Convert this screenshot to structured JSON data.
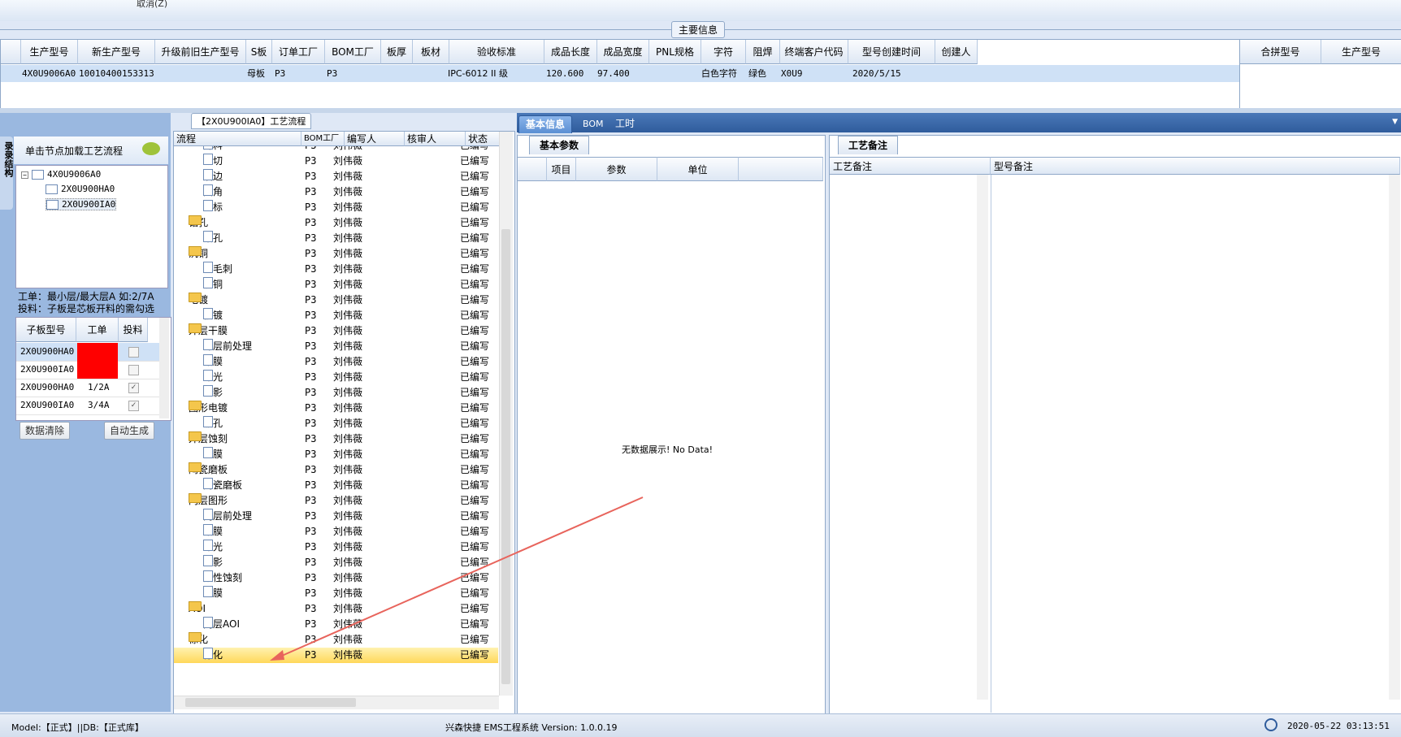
{
  "toolbar": {
    "cancel_label": "取消(Z)"
  },
  "main_info": {
    "title": "主要信息"
  },
  "main_grid": {
    "columns": [
      "生产型号",
      "新生产型号",
      "升级前旧生产型号",
      "S板",
      "订单工厂",
      "BOM工厂",
      "板厚",
      "板材",
      "验收标准",
      "成品长度",
      "成品宽度",
      "PNL规格",
      "字符",
      "阻焊",
      "终端客户代码",
      "型号创建时间",
      "创建人"
    ],
    "row": {
      "model": "4X0U9006A0",
      "new_model": "10010400153313",
      "s_board": "母板",
      "order_factory": "P3",
      "bom_factory": "P3",
      "standard": "IPC-6012 II 级",
      "length": "120.600",
      "width": "97.400",
      "character": "白色字符",
      "solder": "绿色",
      "customer": "X0U9",
      "created": "2020/5/15"
    }
  },
  "side_grid": {
    "columns": [
      "合拼型号",
      "生产型号"
    ]
  },
  "left_panel": {
    "tab_label": "录录结构",
    "load_title": "单击节点加载工艺流程",
    "tree": [
      "4X0U9006A0",
      "2X0U900HA0",
      "2X0U900IA0"
    ],
    "hint_line1": "工单：最小层/最大层A 如:2/7A",
    "hint_line2": "投料：子板是芯板开料的需勾选",
    "sub_columns": [
      "子板型号",
      "工单",
      "投料"
    ],
    "sub_rows": [
      {
        "model": "2X0U900HA0",
        "order": "",
        "red": true,
        "checked": false
      },
      {
        "model": "2X0U900IA0",
        "order": "",
        "red": true,
        "checked": false
      },
      {
        "model": "2X0U900HA0",
        "order": "1/2A",
        "red": false,
        "checked": true
      },
      {
        "model": "2X0U900IA0",
        "order": "3/4A",
        "red": false,
        "checked": true
      }
    ],
    "clear_button": "数据清除",
    "auto_button": "自动生成"
  },
  "process": {
    "title": "【2X0U900IA0】工艺流程",
    "columns": [
      "流程",
      "BOM工厂",
      "编写人",
      "核审人",
      "状态"
    ],
    "rows": [
      {
        "type": "doc",
        "name": "开料",
        "bom": "P3",
        "author": "刘伟薇",
        "status": "已编写"
      },
      {
        "type": "doc",
        "name": "裁切",
        "bom": "P3",
        "author": "刘伟薇",
        "status": "已编写"
      },
      {
        "type": "doc",
        "name": "磨边",
        "bom": "P3",
        "author": "刘伟薇",
        "status": "已编写"
      },
      {
        "type": "doc",
        "name": "圆角",
        "bom": "P3",
        "author": "刘伟薇",
        "status": "已编写"
      },
      {
        "type": "doc",
        "name": "打标",
        "bom": "P3",
        "author": "刘伟薇",
        "status": "已编写"
      },
      {
        "type": "folder",
        "name": "钻孔",
        "bom": "P3",
        "author": "刘伟薇",
        "status": "已编写"
      },
      {
        "type": "doc",
        "name": "钻孔",
        "bom": "P3",
        "author": "刘伟薇",
        "status": "已编写"
      },
      {
        "type": "folder",
        "name": "沉铜",
        "bom": "P3",
        "author": "刘伟薇",
        "status": "已编写"
      },
      {
        "type": "doc",
        "name": "去毛刺",
        "bom": "P3",
        "author": "刘伟薇",
        "status": "已编写"
      },
      {
        "type": "doc",
        "name": "沉铜",
        "bom": "P3",
        "author": "刘伟薇",
        "status": "已编写"
      },
      {
        "type": "folder",
        "name": "电镀",
        "bom": "P3",
        "author": "刘伟薇",
        "status": "已编写"
      },
      {
        "type": "doc",
        "name": "板镀",
        "bom": "P3",
        "author": "刘伟薇",
        "status": "已编写"
      },
      {
        "type": "folder",
        "name": "外层干膜",
        "bom": "P3",
        "author": "刘伟薇",
        "status": "已编写"
      },
      {
        "type": "doc",
        "name": "外层前处理",
        "bom": "P3",
        "author": "刘伟薇",
        "status": "已编写"
      },
      {
        "type": "doc",
        "name": "贴膜",
        "bom": "P3",
        "author": "刘伟薇",
        "status": "已编写"
      },
      {
        "type": "doc",
        "name": "曝光",
        "bom": "P3",
        "author": "刘伟薇",
        "status": "已编写"
      },
      {
        "type": "doc",
        "name": "显影",
        "bom": "P3",
        "author": "刘伟薇",
        "status": "已编写"
      },
      {
        "type": "folder",
        "name": "图形电镀",
        "bom": "P3",
        "author": "刘伟薇",
        "status": "已编写"
      },
      {
        "type": "doc",
        "name": "镀孔",
        "bom": "P3",
        "author": "刘伟薇",
        "status": "已编写"
      },
      {
        "type": "folder",
        "name": "外层蚀刻",
        "bom": "P3",
        "author": "刘伟薇",
        "status": "已编写"
      },
      {
        "type": "doc",
        "name": "退膜",
        "bom": "P3",
        "author": "刘伟薇",
        "status": "已编写"
      },
      {
        "type": "folder",
        "name": "陶瓷磨板",
        "bom": "P3",
        "author": "刘伟薇",
        "status": "已编写"
      },
      {
        "type": "doc",
        "name": "陶瓷磨板",
        "bom": "P3",
        "author": "刘伟薇",
        "status": "已编写"
      },
      {
        "type": "folder",
        "name": "内层图形",
        "bom": "P3",
        "author": "刘伟薇",
        "status": "已编写"
      },
      {
        "type": "doc",
        "name": "内层前处理",
        "bom": "P3",
        "author": "刘伟薇",
        "status": "已编写"
      },
      {
        "type": "doc",
        "name": "贴膜",
        "bom": "P3",
        "author": "刘伟薇",
        "status": "已编写"
      },
      {
        "type": "doc",
        "name": "曝光",
        "bom": "P3",
        "author": "刘伟薇",
        "status": "已编写"
      },
      {
        "type": "doc",
        "name": "显影",
        "bom": "P3",
        "author": "刘伟薇",
        "status": "已编写"
      },
      {
        "type": "doc",
        "name": "酸性蚀刻",
        "bom": "P3",
        "author": "刘伟薇",
        "status": "已编写"
      },
      {
        "type": "doc",
        "name": "退膜",
        "bom": "P3",
        "author": "刘伟薇",
        "status": "已编写"
      },
      {
        "type": "folder",
        "name": "AOI",
        "bom": "P3",
        "author": "刘伟薇",
        "status": "已编写"
      },
      {
        "type": "doc",
        "name": "内层AOI",
        "bom": "P3",
        "author": "刘伟薇",
        "status": "已编写"
      },
      {
        "type": "folder",
        "name": "棕化",
        "bom": "P3",
        "author": "刘伟薇",
        "status": "已编写"
      },
      {
        "type": "doc",
        "name": "棕化",
        "bom": "P3",
        "author": "刘伟薇",
        "status": "已编写",
        "selected": true
      }
    ]
  },
  "tabs": [
    "基本信息",
    "BOM",
    "工时"
  ],
  "basic": {
    "subtab": "基本参数",
    "columns": [
      "项目",
      "参数",
      "单位"
    ],
    "empty": "无数据展示! No Data!"
  },
  "remarks": {
    "subtab": "工艺备注",
    "columns": [
      "工艺备注",
      "型号备注"
    ]
  },
  "status": {
    "left": "Model:【正式】||DB:【正式库】",
    "center": "兴森快捷 EMS工程系统 Version: 1.0.0.19",
    "time": "2020-05-22 03:13:51"
  },
  "colors": {
    "accent": "#2f5c9c",
    "selected_row": "#cfe1f6",
    "warning_red": "#ff0000",
    "highlight": "#ffd85a",
    "arrow": "#e8645c"
  }
}
